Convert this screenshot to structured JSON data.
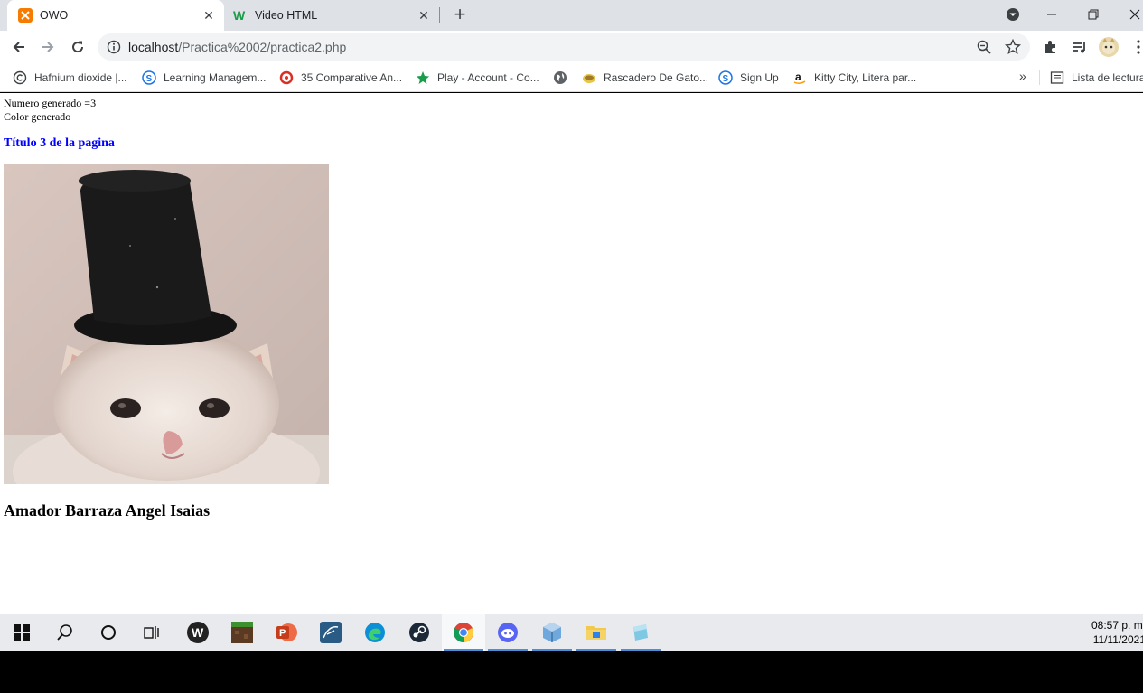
{
  "browser": {
    "tabs": [
      {
        "title": "OWO",
        "icon": "xampp-icon",
        "active": true
      },
      {
        "title": "Video HTML",
        "icon": "w-icon",
        "active": false
      }
    ],
    "address": {
      "host": "localhost",
      "path": "/Practica%2002/practica2.php"
    },
    "bookmarks": [
      {
        "label": "Hafnium dioxide |...",
        "icon": "copyright-icon"
      },
      {
        "label": "Learning Managem...",
        "icon": "s-icon"
      },
      {
        "label": "35 Comparative An...",
        "icon": "red-circle-icon"
      },
      {
        "label": "Play - Account - Co...",
        "icon": "star-icon"
      },
      {
        "label": "",
        "icon": "globe-icon"
      },
      {
        "label": "Rascadero De Gato...",
        "icon": "box-icon"
      },
      {
        "label": "Sign Up",
        "icon": "s-icon"
      },
      {
        "label": "Kitty City, Litera par...",
        "icon": "amazon-icon"
      }
    ],
    "more_bookmarks": "»",
    "reading_list": "Lista de lectura"
  },
  "page": {
    "number_line": "Numero generado =3",
    "color_line": "Color generado",
    "heading": "Título 3 de la pagina",
    "heading_color": "#0000ff",
    "author": "Amador Barraza Angel Isaias"
  },
  "taskbar": {
    "apps": [
      "windows-start-icon",
      "search-icon",
      "cortana-icon",
      "task-view-icon",
      "wamp-icon",
      "minecraft-icon",
      "powerpoint-icon",
      "mysql-workbench-icon",
      "edge-icon",
      "steam-icon",
      "chrome-icon",
      "discord-icon",
      "virtualbox-icon",
      "file-explorer-icon",
      "notepad-icon"
    ],
    "time": "08:57 p. m.",
    "date": "11/11/2021"
  }
}
